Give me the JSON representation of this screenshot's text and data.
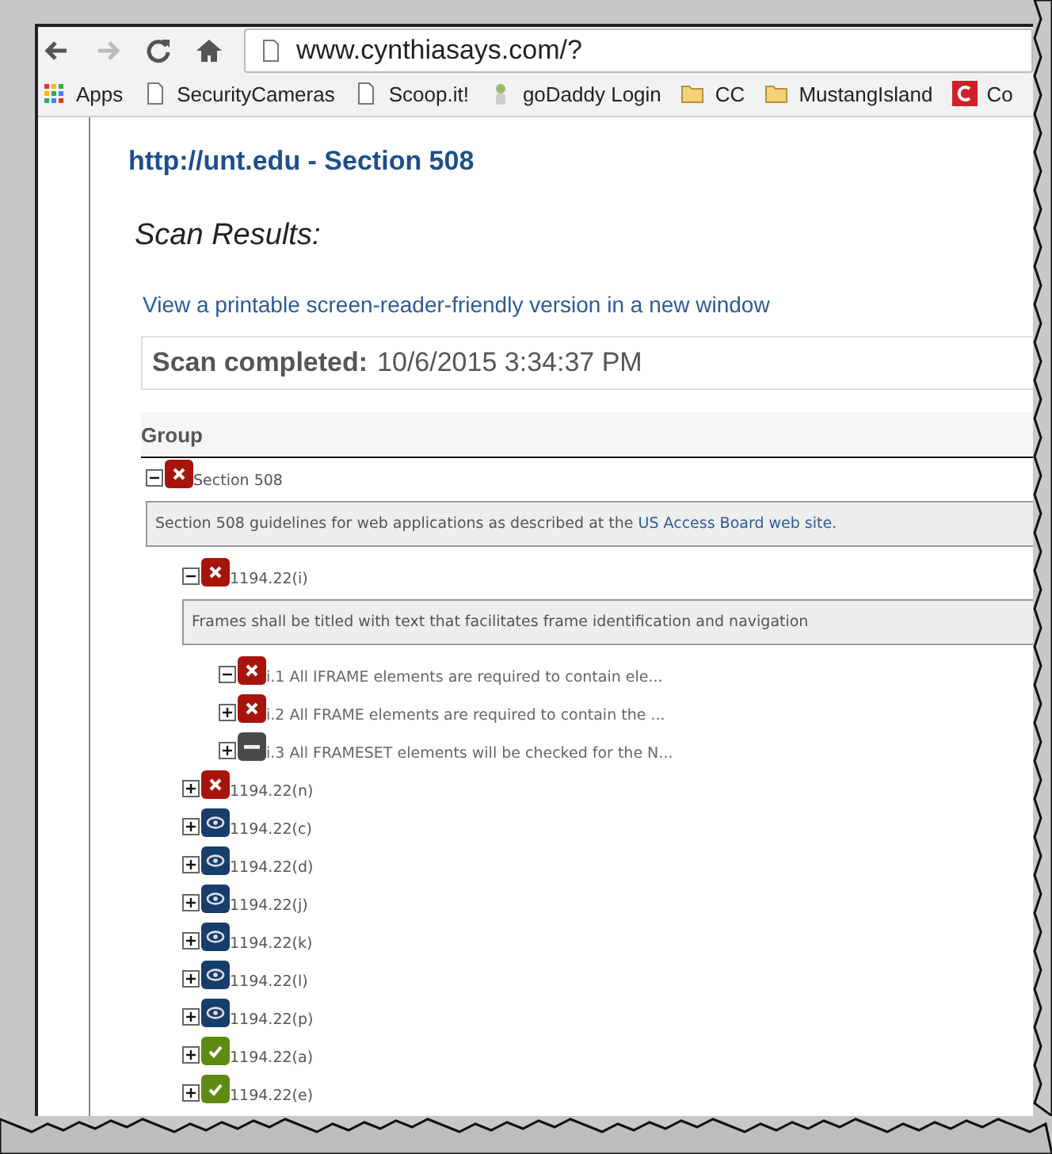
{
  "browser": {
    "url": "www.cynthiasays.com/?",
    "bookmarks": [
      {
        "kind": "apps",
        "label": "Apps"
      },
      {
        "kind": "page",
        "label": "SecurityCameras"
      },
      {
        "kind": "page",
        "label": "Scoop.it!"
      },
      {
        "kind": "mascot",
        "label": "goDaddy Login"
      },
      {
        "kind": "folder",
        "label": "CC"
      },
      {
        "kind": "folder",
        "label": "MustangIsland"
      },
      {
        "kind": "brand",
        "label": "Co"
      }
    ]
  },
  "page": {
    "title": "http://unt.edu - Section 508",
    "heading": "Scan Results:",
    "printable_link": "View a printable screen-reader-friendly version in a new window",
    "scan_label": "Scan completed:",
    "scan_time": "10/6/2015 3:34:37 PM",
    "group_header": "Group",
    "tree": [
      {
        "label": "Section 508",
        "kind": "fail",
        "expanded": true,
        "description": "Section 508 guidelines for web applications as described at the",
        "description_link": "US Access Board web site.",
        "children": [
          {
            "label": "1194.22(i)",
            "kind": "fail",
            "expanded": true,
            "description": "Frames shall be titled with text that facilitates frame identification and navigation",
            "children": [
              {
                "label": "i.1 All IFRAME elements are required to contain ele...",
                "kind": "fail",
                "expanded": true
              },
              {
                "label": "i.2 All FRAME elements are required to contain the ...",
                "kind": "fail",
                "expanded": false
              },
              {
                "label": "i.3 All FRAMESET elements will be checked for the N...",
                "kind": "na",
                "expanded": false
              }
            ]
          },
          {
            "label": "1194.22(n)",
            "kind": "fail",
            "expanded": false
          },
          {
            "label": "1194.22(c)",
            "kind": "review",
            "expanded": false
          },
          {
            "label": "1194.22(d)",
            "kind": "review",
            "expanded": false
          },
          {
            "label": "1194.22(j)",
            "kind": "review",
            "expanded": false
          },
          {
            "label": "1194.22(k)",
            "kind": "review",
            "expanded": false
          },
          {
            "label": "1194.22(l)",
            "kind": "review",
            "expanded": false
          },
          {
            "label": "1194.22(p)",
            "kind": "review",
            "expanded": false
          },
          {
            "label": "1194.22(a)",
            "kind": "pass",
            "expanded": false
          },
          {
            "label": "1194.22(e)",
            "kind": "pass",
            "expanded": false
          }
        ]
      }
    ]
  }
}
